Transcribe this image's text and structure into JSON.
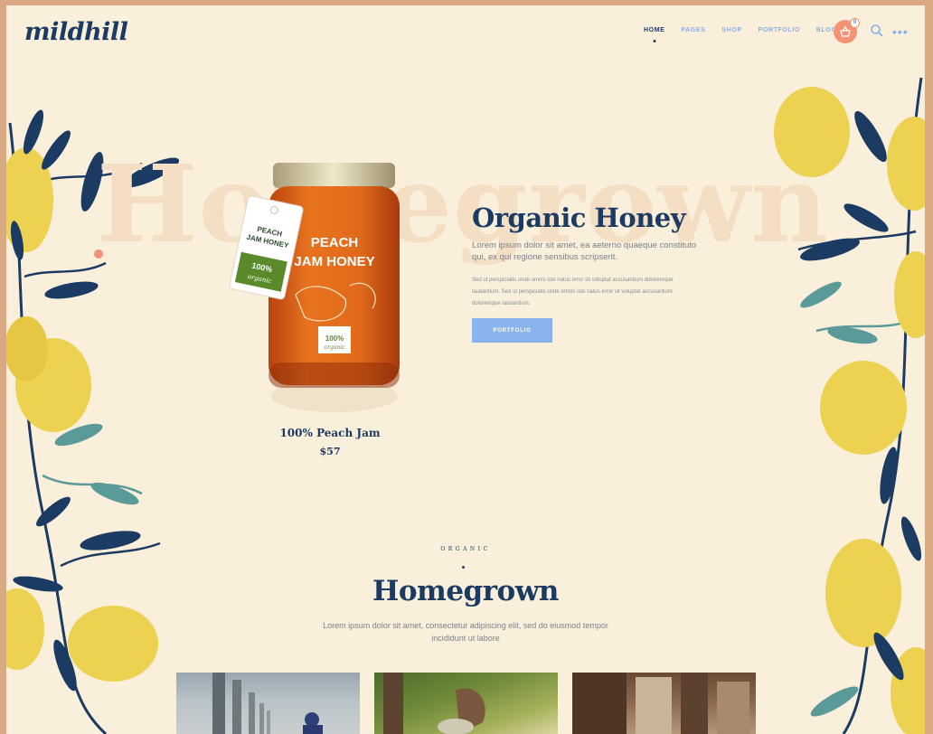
{
  "header": {
    "logo": "mildhill",
    "nav": [
      "HOME",
      "PAGES",
      "SHOP",
      "PORTFOLIO",
      "BLOG"
    ],
    "active_nav": "HOME",
    "cart_count": "0",
    "icons": [
      "basket-icon",
      "search-icon",
      "more-icon"
    ]
  },
  "hero": {
    "background_word": "Homegrown",
    "product": {
      "jar_label": "PEACH\nJAM HONEY",
      "tag_label": "PEACH\nJAM HONEY",
      "badge": "100%\norganic",
      "name": "100% Peach Jam",
      "price": "$57"
    },
    "title": "Organic Honey",
    "lead": "Lorem ipsum dolor sit amet, ea aeterno quaeque constituto qui, ex qui regione sensibus scripserit.",
    "body": "Sed ut perspiciatis unde omnis iste natus error sit voluptat accusantium doloremque laudantium. Sed ut perspiciatis unde omnis iste natus error sit voluptat accusantium doloremque laudantium.",
    "button": "PORTFOLIO"
  },
  "section": {
    "eyebrow": "ORGANIC",
    "title": "Homegrown",
    "subtitle": "Lorem ipsum dolor sit amet, consectetur adipiscing elit, sed do eiusmod tempor incididunt ut labore"
  },
  "colors": {
    "background": "#f9efdb",
    "frame": "#d9a983",
    "navy": "#1c3b63",
    "accent_blue": "#8ab4ee",
    "coral": "#f49374",
    "pear_yellow": "#ecd250",
    "leaf_teal": "#5a9a98"
  }
}
